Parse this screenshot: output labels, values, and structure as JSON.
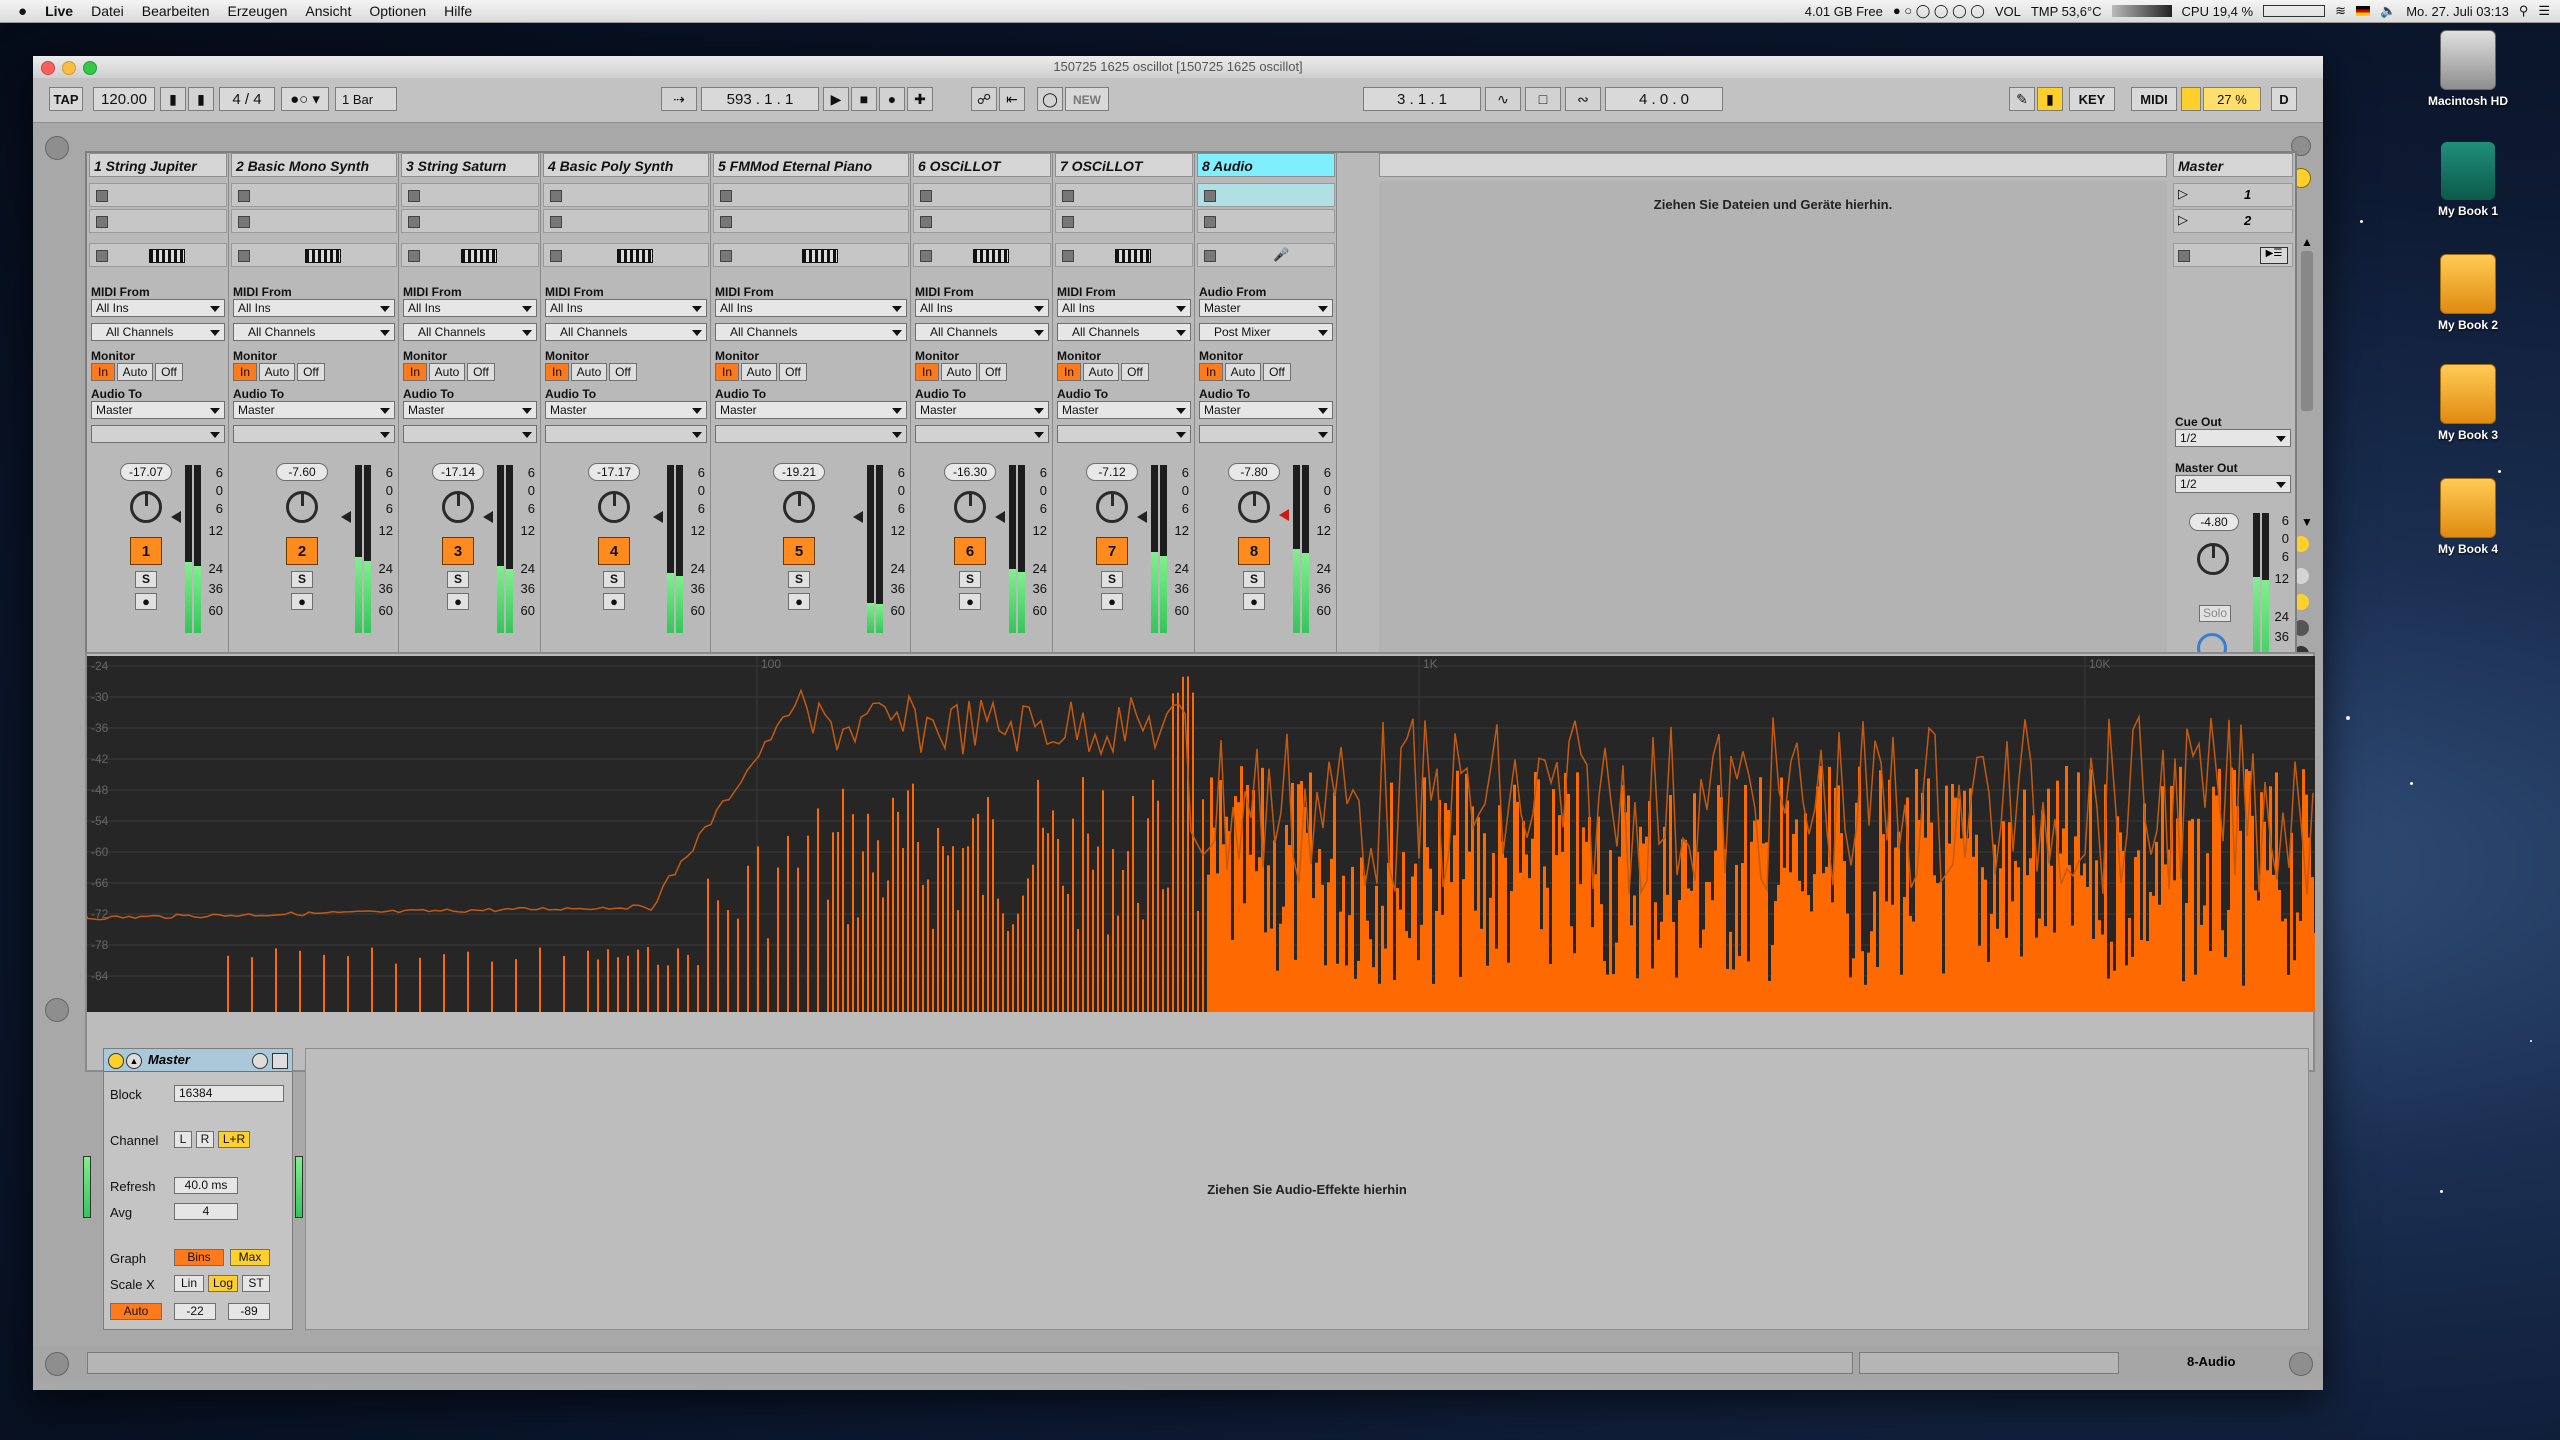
{
  "menubar": {
    "apple": "",
    "items": [
      "Live",
      "Datei",
      "Bearbeiten",
      "Erzeugen",
      "Ansicht",
      "Optionen",
      "Hilfe"
    ],
    "status_disk": "4.01 GB Free",
    "status_vol": "VOL",
    "status_tmp": "TMP 53,6°C",
    "status_cpu": "CPU 19,4 %",
    "status_clock": "Mo. 27. Juli 03:13"
  },
  "desktop": {
    "icons": [
      {
        "label": "Macintosh HD",
        "kind": "harddisk"
      },
      {
        "label": "My Book 1",
        "kind": "timemachine"
      },
      {
        "label": "My Book 2",
        "kind": "external"
      },
      {
        "label": "My Book 3",
        "kind": "external"
      },
      {
        "label": "My Book 4",
        "kind": "external"
      }
    ]
  },
  "window": {
    "title": "150725 1625 oscillot  [150725 1625 oscillot]"
  },
  "toolbar": {
    "tap": "TAP",
    "tempo": "120.00",
    "signature": "4 / 4",
    "quantize": "1 Bar",
    "arrangement_pos": "593 .  1 .  1",
    "new": "NEW",
    "loop_start": "3 .  1 .  1",
    "loop_len": "4 .  0 .  0",
    "key": "KEY",
    "midi": "MIDI",
    "cpu": "27 %",
    "d": "D"
  },
  "session": {
    "drop_text": "Ziehen Sie Dateien und Geräte hierhin.",
    "tracks": [
      {
        "name": "1 String Jupiter",
        "in_label": "MIDI From",
        "in_src": "All Ins",
        "in_ch": "All Channels",
        "monitor": "Monitor",
        "out_label": "Audio To",
        "out": "Master",
        "volume": "-17.07",
        "number": "1",
        "meter": 0.42,
        "audio": false
      },
      {
        "name": "2 Basic Mono Synth",
        "in_label": "MIDI From",
        "in_src": "All Ins",
        "in_ch": "All Channels",
        "monitor": "Monitor",
        "out_label": "Audio To",
        "out": "Master",
        "volume": "-7.60",
        "number": "2",
        "meter": 0.45,
        "audio": false
      },
      {
        "name": "3 String Saturn",
        "in_label": "MIDI From",
        "in_src": "All Ins",
        "in_ch": "All Channels",
        "monitor": "Monitor",
        "out_label": "Audio To",
        "out": "Master",
        "volume": "-17.14",
        "number": "3",
        "meter": 0.4,
        "audio": false
      },
      {
        "name": "4 Basic Poly Synth",
        "in_label": "MIDI From",
        "in_src": "All Ins",
        "in_ch": "All Channels",
        "monitor": "Monitor",
        "out_label": "Audio To",
        "out": "Master",
        "volume": "-17.17",
        "number": "4",
        "meter": 0.36,
        "audio": false
      },
      {
        "name": "5 FMMod Eternal Piano",
        "in_label": "MIDI From",
        "in_src": "All Ins",
        "in_ch": "All Channels",
        "monitor": "Monitor",
        "out_label": "Audio To",
        "out": "Master",
        "volume": "-19.21",
        "number": "5",
        "meter": 0.18,
        "audio": false
      },
      {
        "name": "6 OSCiLLOT",
        "in_label": "MIDI From",
        "in_src": "All Ins",
        "in_ch": "All Channels",
        "monitor": "Monitor",
        "out_label": "Audio To",
        "out": "Master",
        "volume": "-16.30",
        "number": "6",
        "meter": 0.38,
        "audio": false
      },
      {
        "name": "7 OSCiLLOT",
        "in_label": "MIDI From",
        "in_src": "All Ins",
        "in_ch": "All Channels",
        "monitor": "Monitor",
        "out_label": "Audio To",
        "out": "Master",
        "volume": "-7.12",
        "number": "7",
        "meter": 0.48,
        "audio": false
      },
      {
        "name": "8 Audio",
        "in_label": "Audio From",
        "in_src": "Master",
        "in_ch": "Post Mixer",
        "monitor": "Monitor",
        "out_label": "Audio To",
        "out": "Master",
        "volume": "-7.80",
        "number": "8",
        "meter": 0.5,
        "audio": true
      }
    ],
    "monitor_options": [
      "In",
      "Auto",
      "Off"
    ],
    "solo": "S",
    "meter_scale": [
      "6",
      "0",
      "6",
      "12",
      "24",
      "36",
      "60"
    ],
    "master": {
      "name": "Master",
      "scenes": [
        "1",
        "2"
      ],
      "cue_out_label": "Cue Out",
      "cue_out": "1/2",
      "master_out_label": "Master Out",
      "master_out": "1/2",
      "volume": "-4.80",
      "solo": "Solo",
      "meter": 0.62
    }
  },
  "spectrum": {
    "x_labels": [
      "100",
      "1K",
      "10K"
    ],
    "y_labels": [
      "-24",
      "-30",
      "-36",
      "-42",
      "-48",
      "-54",
      "-60",
      "-66",
      "-72",
      "-78",
      "-84"
    ],
    "fill_color": "#ff6a00",
    "line_color": "#c45a10"
  },
  "device": {
    "name": "Master",
    "block_label": "Block",
    "block": "16384",
    "channel_label": "Channel",
    "channel_options": [
      "L",
      "R",
      "L+R"
    ],
    "refresh_label": "Refresh",
    "refresh": "40.0 ms",
    "avg_label": "Avg",
    "avg": "4",
    "graph_label": "Graph",
    "graph_options": [
      "Bins",
      "Max"
    ],
    "scalex_label": "Scale X",
    "scalex_options": [
      "Lin",
      "Log",
      "ST"
    ],
    "auto": "Auto",
    "range_hi": "-22",
    "range_lo": "-89",
    "drop_text": "Ziehen Sie Audio-Effekte hierhin"
  },
  "statusbar": {
    "track": "8-Audio"
  }
}
